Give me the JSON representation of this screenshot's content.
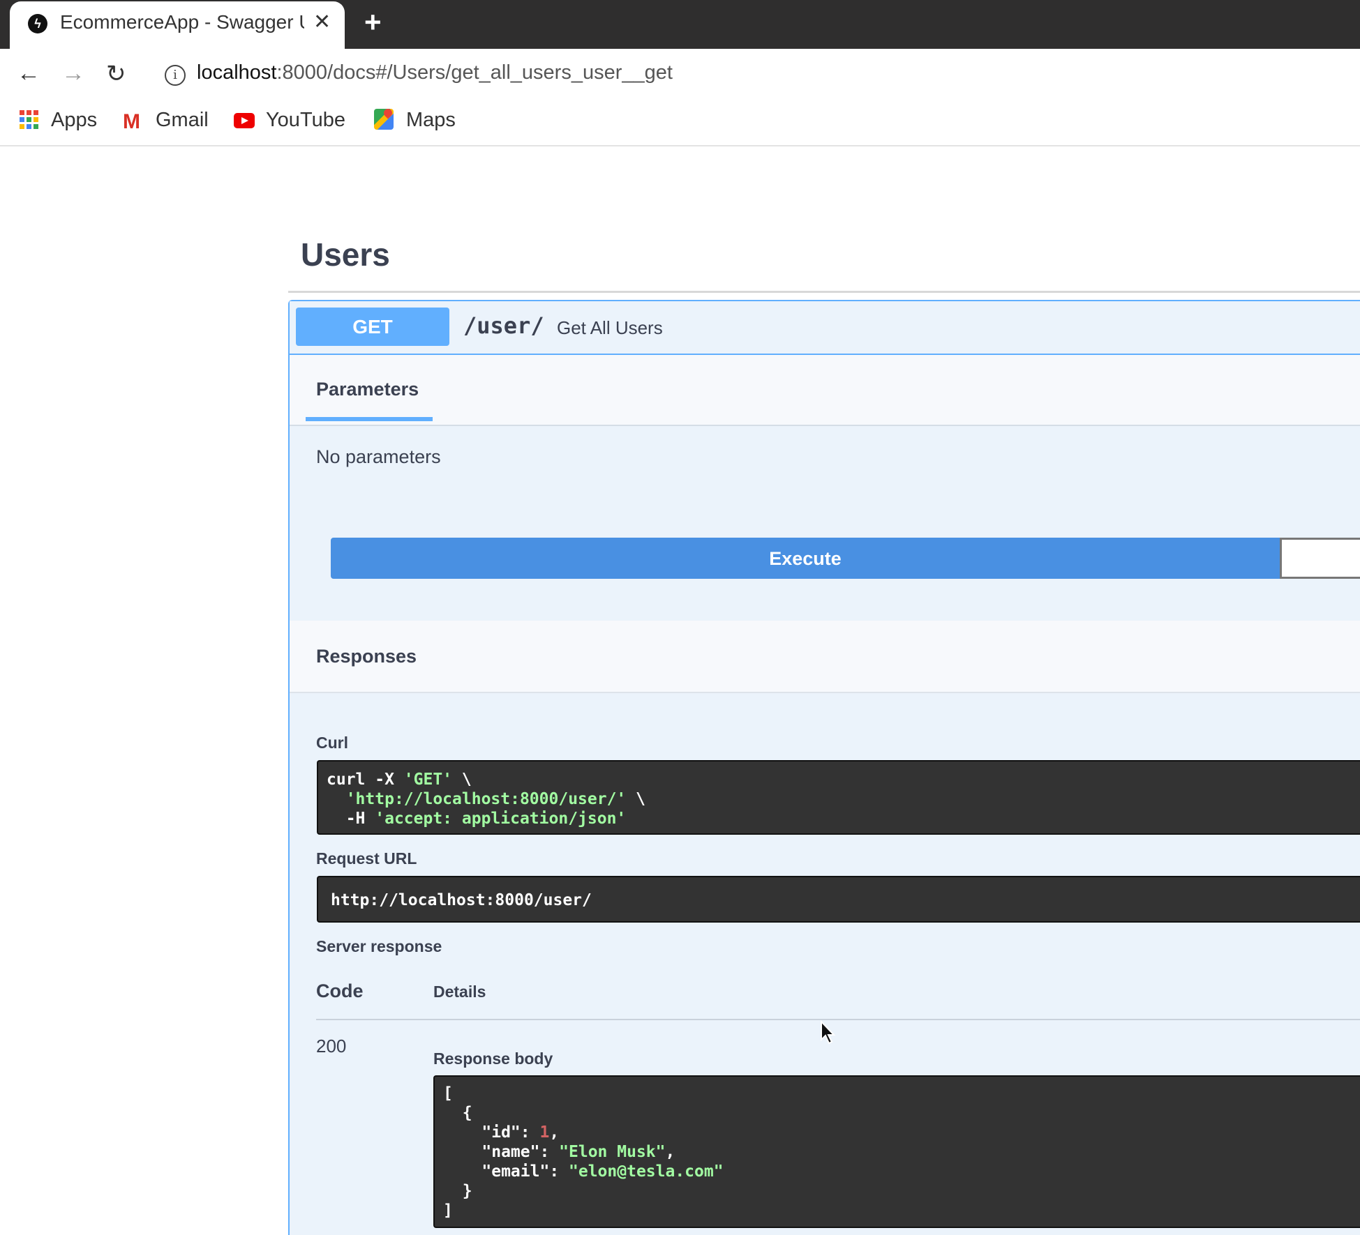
{
  "browser": {
    "tab": {
      "title": "EcommerceApp - Swagger UI",
      "favicon": "fastapi-bolt-icon"
    },
    "new_tab_label": "+",
    "nav": {
      "back": "back-arrow-icon",
      "forward": "forward-arrow-icon",
      "reload": "reload-icon"
    },
    "url": {
      "host": "localhost",
      "rest": ":8000/docs#/Users/get_all_users_user__get"
    },
    "bookmarks": [
      {
        "label": "Apps",
        "icon": "apps-grid-icon"
      },
      {
        "label": "Gmail",
        "icon": "gmail-icon"
      },
      {
        "label": "YouTube",
        "icon": "youtube-icon"
      },
      {
        "label": "Maps",
        "icon": "maps-icon"
      }
    ]
  },
  "section": {
    "title": "Users"
  },
  "operation": {
    "method": "GET",
    "path": "/user/",
    "summary": "Get All Users",
    "tabs": {
      "parameters": "Parameters"
    },
    "no_parameters": "No parameters",
    "execute_label": "Execute",
    "responses_title": "Responses",
    "curl": {
      "label": "Curl",
      "line1_cmd": "curl -X ",
      "line1_str": "'GET'",
      "line1_tail": " \\",
      "line2_pre": "  ",
      "line2_str": "'http://localhost:8000/user/'",
      "line2_tail": " \\",
      "line3_pre": "  -H ",
      "line3_str": "'accept: application/json'"
    },
    "request_url": {
      "label": "Request URL",
      "value": "http://localhost:8000/user/"
    },
    "server_response": {
      "label": "Server response",
      "code_header": "Code",
      "details_header": "Details",
      "code": "200",
      "body_label": "Response body",
      "body": {
        "open_bracket": "[",
        "open_brace": "  {",
        "id_key": "    \"id\": ",
        "id_val": "1",
        "name_key": "    \"name\": ",
        "name_val": "\"Elon Musk\"",
        "email_key": "    \"email\": ",
        "email_val": "\"elon@tesla.com\"",
        "close_brace": "  }",
        "close_bracket": "]"
      }
    }
  },
  "colors": {
    "get_method": "#61affe",
    "execute": "#4990e2",
    "opblock_bg": "#ebf3fb",
    "code_bg": "#333333",
    "code_string": "#a2fca2",
    "code_number": "#d36363"
  }
}
